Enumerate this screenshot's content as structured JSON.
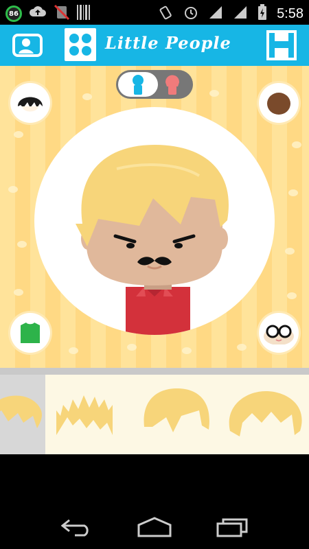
{
  "status_bar": {
    "notification_count": "86",
    "time": "5:58",
    "icons": [
      "upload-icon",
      "muted-icon",
      "barcode-icon",
      "rotate-icon",
      "alarm-icon",
      "signal-icon",
      "signal-icon",
      "battery-charging-icon"
    ]
  },
  "app_bar": {
    "title": "Little People",
    "icons": [
      "profile-card-icon",
      "grid-dots-icon",
      "save-icon"
    ]
  },
  "editor": {
    "gender_options": [
      "male",
      "female"
    ],
    "gender_selected": "male",
    "side_buttons": [
      "hair-style-button",
      "skin-color-button",
      "clothes-button",
      "glasses-button"
    ]
  },
  "hair_options": {
    "items": [
      "hair-style-1",
      "hair-style-2",
      "hair-style-3",
      "hair-style-4"
    ],
    "selected_index": 0
  },
  "colors": {
    "app_bar": "#17b6e5",
    "hair": "#f7d57a",
    "skin": "#e0b89b",
    "shirt": "#d3313b",
    "background_stripe": "#ffe39a",
    "strip_bg": "#fdf8e4"
  },
  "nav_bar": {
    "icons": [
      "back-icon",
      "home-icon",
      "recent-apps-icon"
    ]
  }
}
